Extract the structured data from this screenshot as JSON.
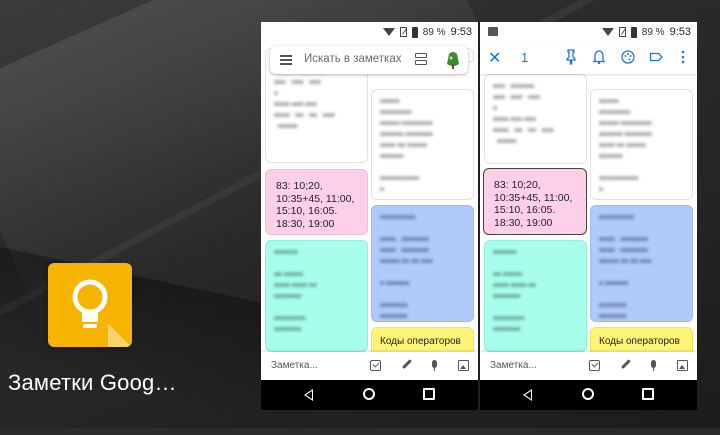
{
  "launcher": {
    "app_label": "Заметки Goog…"
  },
  "status_bar": {
    "battery": "89 %",
    "time": "9:53"
  },
  "phone1": {
    "search_placeholder": "Искать в заметках"
  },
  "phone2": {
    "selected_count": "1"
  },
  "notes": {
    "pink_text": "83:  10;20,\n10:35+45, 11:00,\n15:10, 16:05.\n18:30, 19:00",
    "yellow_title": "Коды операторов"
  },
  "bottom_bar": {
    "hint": "Заметка..."
  },
  "colors": {
    "accent": "#1a73e8",
    "note_pink": "#fdcfe8",
    "note_green": "#a7ffeb",
    "note_blue": "#aecbfa",
    "note_yellow": "#fff475",
    "app_icon": "#f6b400"
  }
}
